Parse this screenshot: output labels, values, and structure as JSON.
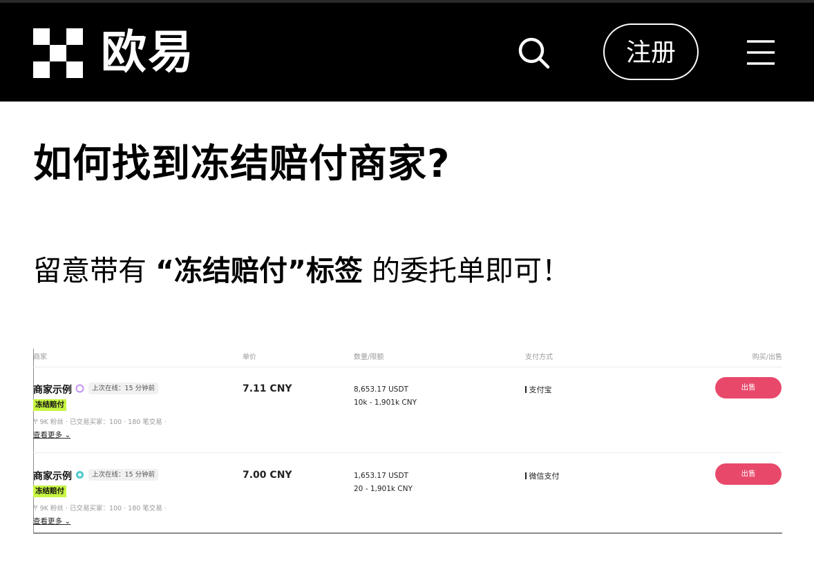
{
  "header": {
    "brand": "欧易",
    "register_label": "注册",
    "search_icon": "search-icon",
    "menu_icon": "menu-icon",
    "background": "#000000"
  },
  "main": {
    "title": "如何找到冻结赔付商家?",
    "subtitle_before": "留意带有 ",
    "subtitle_bold": "“冻结赔付”标签",
    "subtitle_after": " 的委托单即可！"
  },
  "table": {
    "columns": [
      "商家",
      "单价",
      "数量/限额",
      "支付方式",
      "购买/出售"
    ],
    "rows": [
      {
        "merchant": "商家示例",
        "badge_color": "#c79bf5",
        "online": "上次在线：15 分钟前",
        "tag": "冻结赔付",
        "stats": "𐀀 9K 粉丝 · 已交易买家：100 · 180 笔交易 ·",
        "more": "查看更多",
        "price": "7.11 CNY",
        "quantity": "8,653.17 USDT",
        "limit": "10k - 1,901k CNY",
        "payment": "支付宝",
        "action": "出售"
      },
      {
        "merchant": "商家示例",
        "badge_color": "#4fc8c8",
        "online": "上次在线：15 分钟前",
        "tag": "冻结赔付",
        "stats": "𐀀 9K 粉丝 · 已交易买家：100 · 180 笔交易 ·",
        "more": "查看更多",
        "price": "7.00 CNY",
        "quantity": "1,653.17 USDT",
        "limit": "20 - 1,901k CNY",
        "payment": "微信支付",
        "action": "出售"
      }
    ]
  },
  "colors": {
    "accent_pink": "#e8496b",
    "tag_green": "#c6f542"
  }
}
